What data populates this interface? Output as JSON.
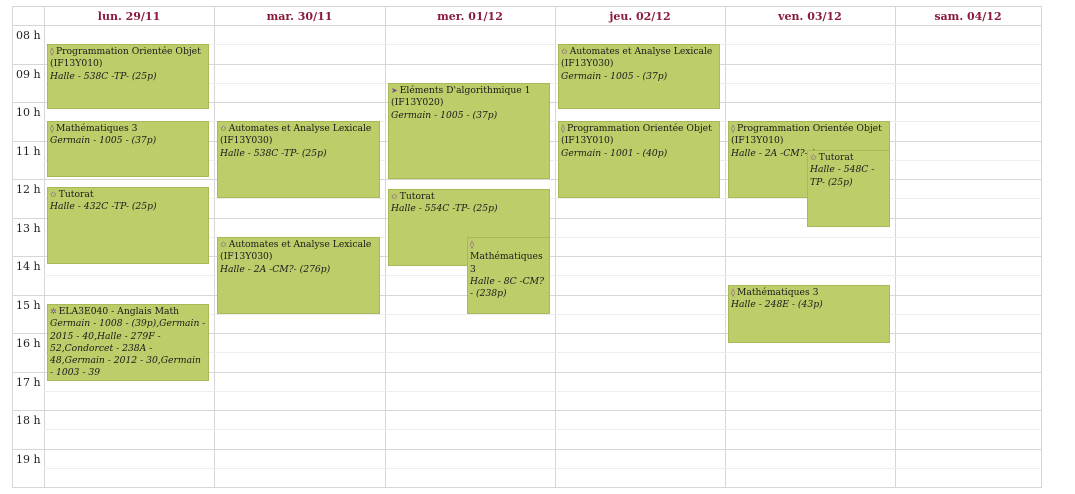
{
  "days": [
    "lun. 29/11",
    "mar. 30/11",
    "mer. 01/12",
    "jeu. 02/12",
    "ven. 03/12",
    "sam. 04/12"
  ],
  "hours": [
    "08 h",
    "09 h",
    "10 h",
    "11 h",
    "12 h",
    "13 h",
    "14 h",
    "15 h",
    "16 h",
    "17 h",
    "18 h",
    "19 h"
  ],
  "events": [
    {
      "day": 0,
      "start": 8.5,
      "end": 10.2,
      "icon": "diamond-icon",
      "glyph": "◊",
      "title": "Programmation Orientée Objet",
      "code": "(IF13Y010)",
      "location": "Halle - 538C -TP- (25p)"
    },
    {
      "day": 0,
      "start": 10.5,
      "end": 11.95,
      "icon": "diamond-icon",
      "glyph": "◊",
      "title": "Mathématiques 3",
      "code": "",
      "location": "Germain - 1005 - (37p)"
    },
    {
      "day": 0,
      "start": 12.2,
      "end": 14.2,
      "icon": "star-icon",
      "glyph": "✩",
      "title": "Tutorat",
      "code": "",
      "location": "Halle - 432C -TP- (25p)"
    },
    {
      "day": 0,
      "start": 15.25,
      "end": 17.25,
      "icon": "gear-icon",
      "glyph": "✲",
      "title": "ELA3E040 - Anglais Math",
      "code": "",
      "location": "Germain - 1008 - (39p),Germain - 2015 - 40,Halle - 279F - 52,Condorcet - 238A - 48,Germain - 2012 - 30,Germain - 1003 - 39"
    },
    {
      "day": 1,
      "start": 10.5,
      "end": 12.5,
      "icon": "star-icon",
      "glyph": "✩",
      "title": "Automates et Analyse Lexicale",
      "code": "(IF13Y030)",
      "location": "Halle - 538C -TP- (25p)"
    },
    {
      "day": 1,
      "start": 13.5,
      "end": 15.5,
      "icon": "star-icon",
      "glyph": "✩",
      "title": "Automates et Analyse Lexicale",
      "code": "(IF13Y030)",
      "location": "Halle - 2A -CM?- (276p)"
    },
    {
      "day": 2,
      "start": 9.5,
      "end": 12.0,
      "icon": "arrow-icon",
      "glyph": "➤",
      "title": "Eléments D'algorithmique 1",
      "code": "(IF13Y020)",
      "location": "Germain - 1005 - (37p)"
    },
    {
      "day": 2,
      "start": 12.25,
      "end": 14.25,
      "icon": "star-icon",
      "glyph": "✩",
      "title": "Tutorat",
      "code": "",
      "location": "Halle - 554C -TP- (25p)"
    },
    {
      "day": 2,
      "start": 13.5,
      "end": 15.5,
      "icon": "diamond-icon",
      "glyph": "◊",
      "title": "Mathématiques 3",
      "code": "",
      "location": "Halle - 8C -CM?- (238p)",
      "half": "right"
    },
    {
      "day": 3,
      "start": 8.5,
      "end": 10.2,
      "icon": "star-icon",
      "glyph": "✩",
      "title": "Automates et Analyse Lexicale",
      "code": "(IF13Y030)",
      "location": "Germain - 1005 - (37p)"
    },
    {
      "day": 3,
      "start": 10.5,
      "end": 12.5,
      "icon": "diamond-icon",
      "glyph": "◊",
      "title": "Programmation Orientée Objet",
      "code": "(IF13Y010)",
      "location": "Germain - 1001 - (40p)"
    },
    {
      "day": 4,
      "start": 10.5,
      "end": 12.5,
      "icon": "diamond-icon",
      "glyph": "◊",
      "title": "Programmation Orientée Objet",
      "code": "(IF13Y010)",
      "location": "Halle - 2A -CM?- (",
      "half": "left"
    },
    {
      "day": 4,
      "start": 11.25,
      "end": 13.25,
      "icon": "star-icon",
      "glyph": "✩",
      "title": "Tutorat",
      "code": "",
      "location": "Halle - 548C -TP- (25p)",
      "half": "right"
    },
    {
      "day": 4,
      "start": 14.75,
      "end": 16.25,
      "icon": "diamond-icon",
      "glyph": "◊",
      "title": "Mathématiques 3",
      "code": "",
      "location": "Halle - 248E - (43p)"
    }
  ]
}
